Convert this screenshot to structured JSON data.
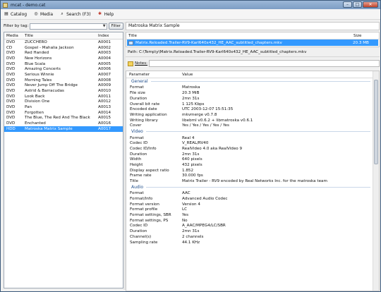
{
  "window": {
    "title": "mcat - demo.cat"
  },
  "menu": [
    {
      "label": "Catalog",
      "icon": "catalog-icon"
    },
    {
      "label": "Media",
      "icon": "media-icon"
    },
    {
      "label": "Search (F3)",
      "icon": "search-icon"
    },
    {
      "label": "Help",
      "icon": "help-icon"
    }
  ],
  "filter": {
    "label": "Filter by tag:",
    "button": "Filter",
    "value": ""
  },
  "media_list": {
    "columns": [
      "Media",
      "Title",
      "Index"
    ],
    "rows": [
      [
        "DVD",
        "ZUCCHERO",
        "A0001"
      ],
      [
        "CD",
        "Gospel - Mahalia Jackson",
        "A0002"
      ],
      [
        "DVD",
        "Red Handed",
        "A0003"
      ],
      [
        "DVD",
        "New Horizons",
        "A0004"
      ],
      [
        "DVD",
        "Blue Scala",
        "A0005"
      ],
      [
        "DVD",
        "Amazing Concerts",
        "A0006"
      ],
      [
        "DVD",
        "Serious Winnie",
        "A0007"
      ],
      [
        "DVD",
        "Morning Tales",
        "A0008"
      ],
      [
        "DVD",
        "Never Jump Off The Bridge",
        "A0009"
      ],
      [
        "DVD",
        "Astrid & Barracudas",
        "A0010"
      ],
      [
        "DVD",
        "Look Back",
        "A0011"
      ],
      [
        "DVD",
        "Division One",
        "A0012"
      ],
      [
        "DVD",
        "Pan",
        "A0013"
      ],
      [
        "DVD",
        "Forgotten",
        "A0014"
      ],
      [
        "DVD",
        "The Blue, The Red And The Black",
        "A0015"
      ],
      [
        "DVD",
        "Enchanted",
        "A0016"
      ],
      [
        "HDD",
        "Matroska Matrix Sample",
        "A0017"
      ]
    ],
    "selected_index": 16
  },
  "detail": {
    "title": "Matroska Matrix Sample",
    "files_header": {
      "title": "Title",
      "size": "Size"
    },
    "file": {
      "name": "Matrix.Reloaded.Trailer-RV9-Karl640x432_HE_AAC_subtitled_chapters.mkv",
      "size": "20.3 MB"
    },
    "path": "Path:  C:\\Temp\\y\\Matrix.Reloaded.Trailer-RV9-Karl640x432_HE_AAC_subtitled_chapters.mkv",
    "notes_label": "Notes:",
    "props_header": {
      "param": "Parameter",
      "value": "Value"
    },
    "sections": [
      {
        "name": "General",
        "rows": [
          [
            "Format",
            "Matroska"
          ],
          [
            "File size",
            "20.3 MiB"
          ],
          [
            "Duration",
            "2mn 31s"
          ],
          [
            "Overall bit rate",
            "1 125 Kbps"
          ],
          [
            "Encoded date",
            "UTC 2003-12-07 15:51:35"
          ],
          [
            "Writing application",
            "mkvmerge v0.7.8"
          ],
          [
            "Writing library",
            "libebml v0.6.2 + libmatroska v0.6.1"
          ],
          [
            "Cover",
            "Yes / Yes / Yes / Yes / Yes"
          ]
        ]
      },
      {
        "name": "Video",
        "rows": [
          [
            "Format",
            "Real 4"
          ],
          [
            "Codec ID",
            "V_REAL/RV40"
          ],
          [
            "Codec ID/Info",
            "RealVideo 4.0 aka RealVideo 9"
          ],
          [
            "Duration",
            "2mn 31s"
          ],
          [
            "Width",
            "640 pixels"
          ],
          [
            "Height",
            "432 pixels"
          ],
          [
            "Display aspect ratio",
            "1.852"
          ],
          [
            "Frame rate",
            "30.000 fps"
          ],
          [
            "Title",
            "Matrix Trailer - RV9 encoded by Real Networks Inc. for the matroska team"
          ]
        ]
      },
      {
        "name": "Audio",
        "rows": [
          [
            "Format",
            "AAC"
          ],
          [
            "Format/Info",
            "Advanced Audio Codec"
          ],
          [
            "Format version",
            "Version 4"
          ],
          [
            "Format profile",
            "LC"
          ],
          [
            "Format settings, SBR",
            "Yes"
          ],
          [
            "Format settings, PS",
            "No"
          ],
          [
            "Codec ID",
            "A_AAC/MPEG4/LC/SBR"
          ],
          [
            "Duration",
            "2mn 31s"
          ],
          [
            "Channel(s)",
            "2 channels"
          ],
          [
            "Sampling rate",
            "44.1 KHz"
          ]
        ]
      }
    ]
  }
}
